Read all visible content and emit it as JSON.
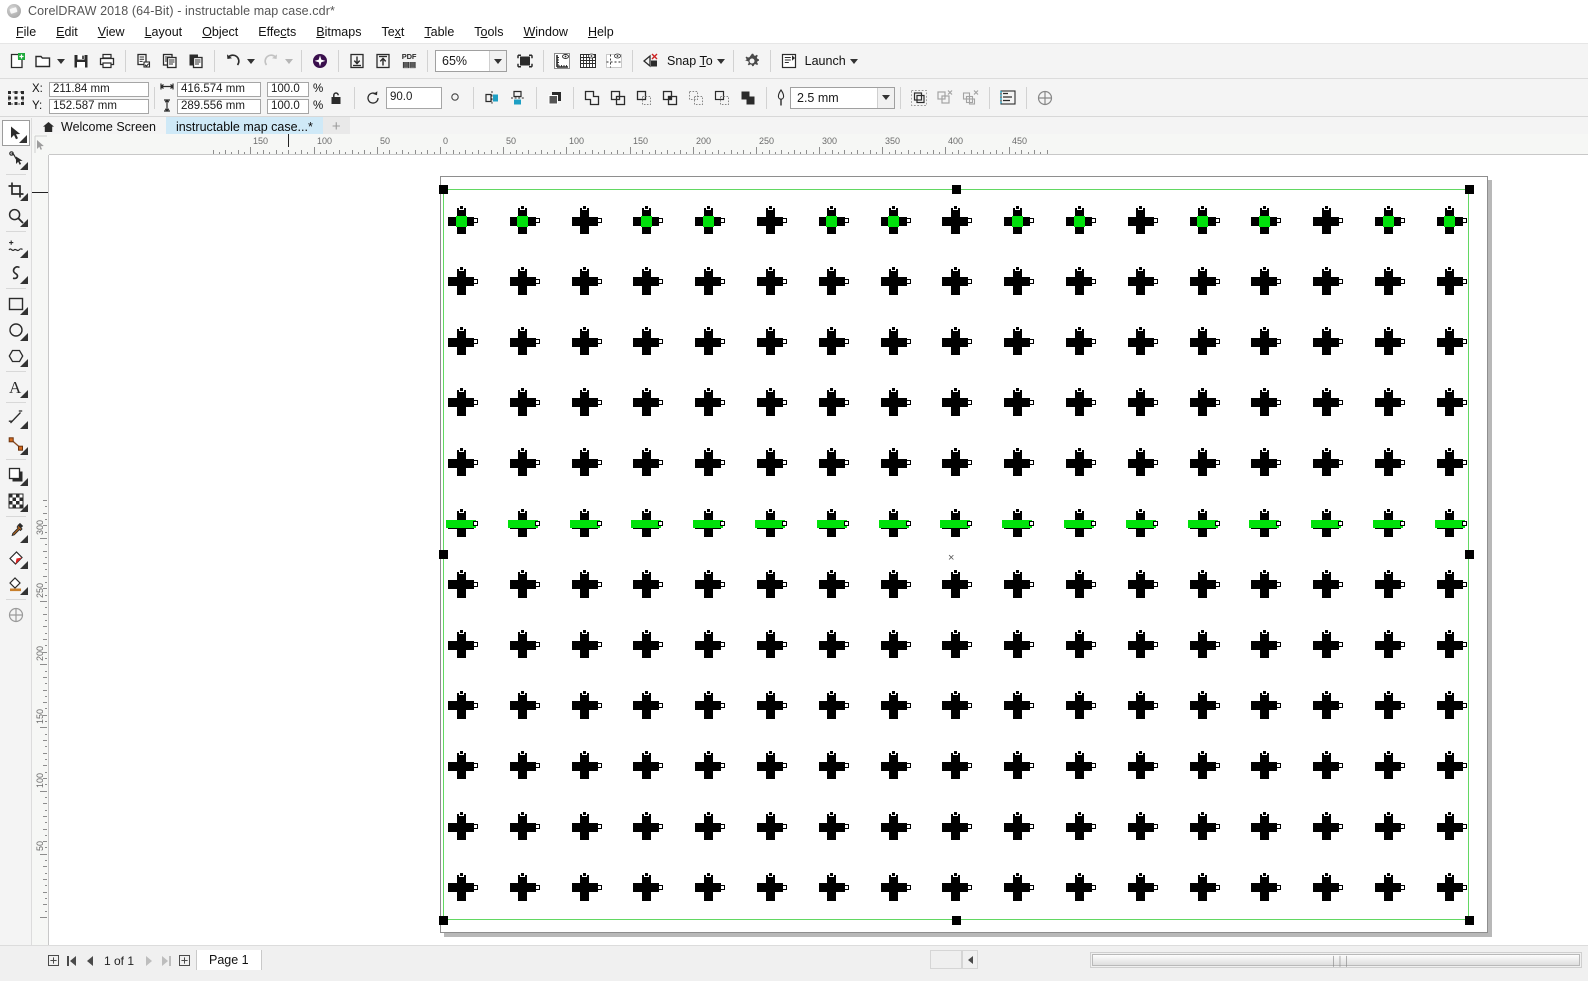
{
  "window": {
    "title": "CorelDRAW 2018 (64-Bit) - instructable map case.cdr*",
    "logo_icon": "coreldraw-logo-icon"
  },
  "menubar": {
    "items": [
      {
        "label": "File",
        "mnemonic": "F"
      },
      {
        "label": "Edit",
        "mnemonic": "E"
      },
      {
        "label": "View",
        "mnemonic": "V"
      },
      {
        "label": "Layout",
        "mnemonic": "L"
      },
      {
        "label": "Object",
        "mnemonic": "O"
      },
      {
        "label": "Effects",
        "mnemonic": "c"
      },
      {
        "label": "Bitmaps",
        "mnemonic": "B"
      },
      {
        "label": "Text",
        "mnemonic": "x"
      },
      {
        "label": "Table",
        "mnemonic": "T"
      },
      {
        "label": "Tools",
        "mnemonic": "o"
      },
      {
        "label": "Window",
        "mnemonic": "W"
      },
      {
        "label": "Help",
        "mnemonic": "H"
      }
    ]
  },
  "standard_toolbar": {
    "buttons": [
      {
        "name": "new-document-icon",
        "tip": "New"
      },
      {
        "name": "open-document-icon",
        "tip": "Open"
      },
      {
        "name": "save-document-icon",
        "tip": "Save"
      },
      {
        "name": "print-icon",
        "tip": "Print"
      },
      {
        "name": "cut-icon",
        "tip": "Cut"
      },
      {
        "name": "copy-icon",
        "tip": "Copy"
      },
      {
        "name": "paste-icon",
        "tip": "Paste"
      },
      {
        "name": "undo-icon",
        "tip": "Undo"
      },
      {
        "name": "redo-icon",
        "tip": "Redo"
      },
      {
        "name": "corel-connect-icon",
        "tip": "Search Content"
      },
      {
        "name": "import-icon",
        "tip": "Import"
      },
      {
        "name": "export-icon",
        "tip": "Export"
      },
      {
        "name": "publish-pdf-icon",
        "tip": "Publish to PDF"
      },
      {
        "name": "full-screen-preview-icon",
        "tip": "Full-Screen Preview"
      },
      {
        "name": "show-rulers-icon",
        "tip": "Rulers"
      },
      {
        "name": "show-grid-icon",
        "tip": "Grid"
      },
      {
        "name": "show-guidelines-icon",
        "tip": "Guidelines"
      },
      {
        "name": "snap-off-icon",
        "tip": "Snap Off"
      },
      {
        "name": "options-gear-icon",
        "tip": "Options"
      },
      {
        "name": "launch-icon",
        "tip": "Application Launcher"
      }
    ],
    "zoom_level": "65%",
    "snap_to_label": "Snap To",
    "snap_to_mnemonic": "T",
    "launch_label": "Launch"
  },
  "property_bar": {
    "object_position_icon": "object-position-icon",
    "x_label": "X:",
    "x_value": "211.84 mm",
    "y_label": "Y:",
    "y_value": "152.587 mm",
    "width_icon": "object-width-icon",
    "width_value": "416.574 mm",
    "height_icon": "object-height-icon",
    "height_value": "289.556 mm",
    "scale_h": "100.0",
    "scale_v": "100.0",
    "percent_sign": "%",
    "lock_ratio_icon": "lock-ratio-icon",
    "rotate_icon": "rotation-angle-icon",
    "rotation_angle": "90.0",
    "rotate_unit_icon": "degree-icon",
    "mirror_horizontal_icon": "mirror-horizontal-icon",
    "mirror_vertical_icon": "mirror-vertical-icon",
    "order_icon": "to-front-icon",
    "weld_icon": "weld-icon",
    "trim_icon": "trim-icon",
    "intersect_icon": "intersect-icon",
    "simplify_icon": "simplify-icon",
    "front-minus-back_icon": "front-minus-back-icon",
    "back-minus-front_icon": "back-minus-front-icon",
    "boundary_icon": "create-boundary-icon",
    "outline_pen_icon": "outline-width-pen-icon",
    "outline_width": "2.5 mm",
    "group_icon": "group-icon",
    "ungroup_icon": "ungroup-icon",
    "ungroup_all_icon": "ungroup-all-icon",
    "align_icon": "align-and-distribute-icon",
    "edit_bitmap_icon": "convert-outline-to-object-icon"
  },
  "document_tabs": {
    "home_icon": "home-icon",
    "tabs": [
      {
        "label": "Welcome Screen",
        "active": false
      },
      {
        "label": "instructable map case...*",
        "active": true
      }
    ],
    "add_tab_label": "+"
  },
  "toolbox": {
    "tools": [
      {
        "name": "pick-tool",
        "selected": true
      },
      {
        "name": "shape-tool",
        "selected": false
      },
      {
        "name": "crop-tool",
        "selected": false
      },
      {
        "name": "zoom-tool",
        "selected": false
      },
      {
        "name": "freehand-tool",
        "selected": false
      },
      {
        "name": "artistic-media-tool",
        "selected": false
      },
      {
        "name": "rectangle-tool",
        "selected": false
      },
      {
        "name": "ellipse-tool",
        "selected": false
      },
      {
        "name": "polygon-tool",
        "selected": false
      },
      {
        "name": "text-tool",
        "selected": false
      },
      {
        "name": "dimension-tool",
        "selected": false
      },
      {
        "name": "connector-tool",
        "selected": false
      },
      {
        "name": "drop-shadow-tool",
        "selected": false
      },
      {
        "name": "transparency-tool",
        "selected": false
      },
      {
        "name": "color-eyedropper-tool",
        "selected": false
      },
      {
        "name": "interactive-fill-tool",
        "selected": false
      },
      {
        "name": "smart-fill-tool",
        "selected": false
      },
      {
        "name": "outline-color-tool",
        "selected": false
      }
    ]
  },
  "rulers": {
    "unit": "mm",
    "horizontal_labels": [
      "150",
      "100",
      "50",
      "0",
      "50",
      "100",
      "150",
      "200",
      "250",
      "300",
      "350",
      "400",
      "450"
    ],
    "vertical_labels": [
      "300",
      "250",
      "200",
      "150",
      "100",
      "50"
    ]
  },
  "canvas": {
    "selection_note": "grid of cross/plus shapes on page, selected object",
    "rotation_center_marker": "×",
    "colors": {
      "page_outline": "#8e8e8e",
      "selection_outline": "#62d862",
      "object_fill": "#000000",
      "highlight_fill": "#00e10b",
      "page_shadow": "#b8b8b8"
    },
    "grid": {
      "columns": 17,
      "rows": 12,
      "green_accent_row_index": 5,
      "green_accent_top_row_pattern": [
        1,
        1,
        0,
        1,
        1,
        0,
        1,
        1,
        0,
        1,
        1,
        0,
        1,
        1,
        0,
        1,
        1
      ]
    }
  },
  "status_bar": {
    "first_page_icon": "first-page-icon",
    "prev_page_icon": "previous-page-icon",
    "page_indicator": "1 of 1",
    "next_page_icon": "next-page-icon",
    "last_page_icon": "last-page-icon",
    "add_page_icon": "add-page-icon",
    "page_tab_label": "Page 1",
    "scrollbar_grip_icon": "scrollbar-grip-icon",
    "scroll_left_icon": "scroll-left-icon"
  }
}
